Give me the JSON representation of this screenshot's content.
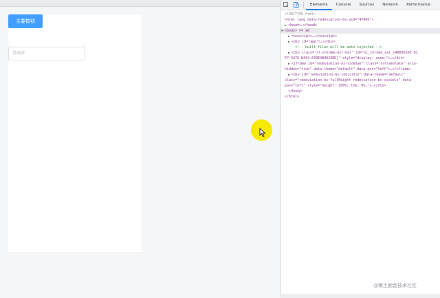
{
  "app": {
    "primary_button_label": "主要按钮",
    "select_placeholder": "请选择"
  },
  "devtools": {
    "tabs": [
      "Elements",
      "Console",
      "Sources",
      "Network",
      "Performance"
    ],
    "active_tab": "Elements",
    "lines": [
      {
        "gutter": "",
        "indent": 0,
        "expand": "",
        "text": "<!DOCTYPE html>"
      },
      {
        "gutter": "",
        "indent": 0,
        "expand": "",
        "text": "<html lang data-redeviation-bs-uid=\"47406\">"
      },
      {
        "gutter": "",
        "indent": 1,
        "expand": "▶",
        "text": "<head>…</head>"
      },
      {
        "gutter": "···",
        "indent": 0,
        "expand": "▼",
        "text": "<body> == $0"
      },
      {
        "gutter": "",
        "indent": 2,
        "expand": "▶",
        "text": "<noscript>…</noscript>"
      },
      {
        "gutter": "",
        "indent": 2,
        "expand": "▶",
        "text": "<div id=\"app\">…</div>"
      },
      {
        "gutter": "",
        "indent": 3,
        "expand": "",
        "text": "<!-- built files will be auto injected -->"
      },
      {
        "gutter": "",
        "indent": 2,
        "expand": "▶",
        "text": "<div class=\"xl-chrome-ext-bar\" id=\"xl_chrome_ext_{4DB361DE-01"
      },
      {
        "gutter": "",
        "indent": 0,
        "expand": "",
        "text": "F7-4376-B494-639E489D19ED}\" style=\"display: none;\">…</div>"
      },
      {
        "gutter": "",
        "indent": 2,
        "expand": "▶",
        "text": "<iframe id=\"redeviation-bs-sidebar\" class=\"notranslate\" aria-"
      },
      {
        "gutter": "",
        "indent": 0,
        "expand": "",
        "text": "hidden=\"true\" data-theme=\"default\" data-pos=\"left\">…</iframe>"
      },
      {
        "gutter": "",
        "indent": 2,
        "expand": "▶",
        "text": "<div id=\"redeviation-bs-indicator\" data-theme=\"default\""
      },
      {
        "gutter": "",
        "indent": 0,
        "expand": "",
        "text": "class=\"redeviation-bs-fullHeight redeviation-bs-visible\" data-"
      },
      {
        "gutter": "",
        "indent": 0,
        "expand": "",
        "text": "pos=\"left\" style=\"height: 100%; top: 0%;\">…</div>"
      },
      {
        "gutter": "",
        "indent": 1,
        "expand": "",
        "text": "</body>"
      },
      {
        "gutter": "",
        "indent": 0,
        "expand": "",
        "text": "</html>"
      }
    ]
  },
  "watermark": "@稀土掘金技术社区",
  "colors": {
    "primary": "#409eff",
    "cursor_highlight": "#f6ea00",
    "active_tab_underline": "#1a73e8"
  },
  "icons": [
    "inspect-element-icon",
    "device-toggle-icon",
    "cursor-arrow-icon"
  ]
}
